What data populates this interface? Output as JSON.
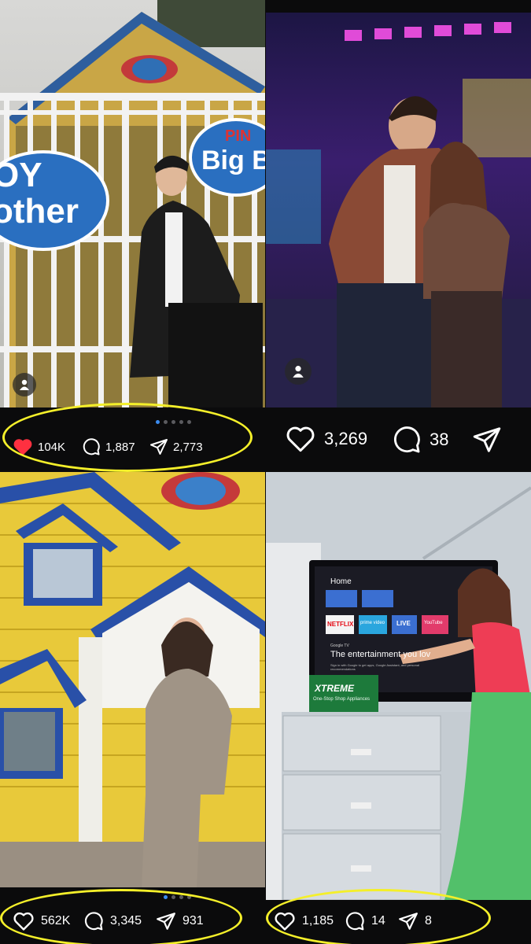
{
  "posts": [
    {
      "signage": {
        "left_sign": "OY\nother",
        "right_sign_top": "PIN",
        "right_sign_main": "Big B"
      },
      "likes": "104K",
      "comments": "1,887",
      "shares": "2,773",
      "liked": true,
      "carousel_dots": 5,
      "carousel_active": 0
    },
    {
      "likes": "3,269",
      "comments": "38"
    },
    {
      "likes": "562K",
      "comments": "3,345",
      "shares": "931",
      "carousel_dots": 4,
      "carousel_active": 0
    },
    {
      "tv": {
        "home": "Home",
        "apps": [
          "NETFLIX",
          "prime video",
          "LIVE",
          "YouTube"
        ],
        "google_tv": "Google TV",
        "headline": "The entertainment you lov",
        "subtext": "Sign in with Google to get apps, Google Assistant, and personal recommendations"
      },
      "box": {
        "brand": "XTREME",
        "tagline": "One-Stop Shop Appliances"
      },
      "likes": "1,185",
      "comments": "14",
      "shares": "8"
    }
  ],
  "colors": {
    "background": "#0b0b0c",
    "highlight_oval": "#f4ef2a",
    "liked_heart": "#ff3040",
    "carousel_active": "#3b8cf0"
  },
  "icons": [
    "heart-icon",
    "comment-icon",
    "share-icon",
    "user-icon"
  ]
}
